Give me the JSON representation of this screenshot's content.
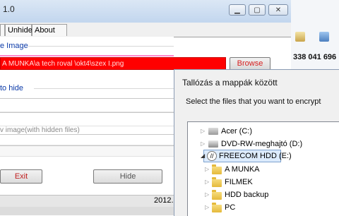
{
  "app": {
    "title": "1.0",
    "tabs": [
      "Unhide",
      "About Me"
    ],
    "window_controls": {
      "minimize": "▁",
      "maximize": "▢",
      "close": "✕"
    }
  },
  "main": {
    "group_image_label": "e Image",
    "image_path": " A MUNKA\\a tech roval \\okt4\\szex I.png",
    "browse_label": "Browse",
    "group_hide_label": "to hide",
    "preview_label": "v image(with hidden files)",
    "exit_label": "Exit",
    "hide_label": "Hide",
    "status_text": "2012."
  },
  "background_app": {
    "phone_text": "338 041 696"
  },
  "dialog": {
    "title": "Tallózás a mappák között",
    "prompt": "Select the files that you want to encrypt",
    "tree": [
      {
        "label": "Acer (C:)",
        "icon": "drive-icon",
        "expanded": false
      },
      {
        "label": "DVD-RW-meghajtó (D:)",
        "icon": "dvd-drive-icon",
        "expanded": false
      },
      {
        "label": "FREECOM HDD (E:)",
        "icon": "external-drive-icon",
        "expanded": true,
        "selected": true
      },
      {
        "label": "A MUNKA",
        "icon": "folder-icon",
        "expanded": false
      },
      {
        "label": "FILMEK",
        "icon": "folder-icon",
        "expanded": false
      },
      {
        "label": "HDD backup",
        "icon": "folder-icon",
        "expanded": false
      },
      {
        "label": "PC",
        "icon": "folder-icon",
        "expanded": false
      }
    ]
  },
  "colors": {
    "path_field_bg": "#ff0000",
    "group_label": "#0b3aa8",
    "selection": "#dcebfc"
  }
}
